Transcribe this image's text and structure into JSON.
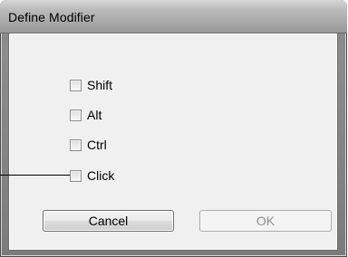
{
  "dialog": {
    "title": "Define Modifier",
    "checkboxes": [
      {
        "label": "Shift",
        "checked": false
      },
      {
        "label": "Alt",
        "checked": false
      },
      {
        "label": "Ctrl",
        "checked": false
      },
      {
        "label": "Click",
        "checked": false
      }
    ],
    "cancel_label": "Cancel",
    "ok_label": "OK",
    "ok_enabled": false
  }
}
